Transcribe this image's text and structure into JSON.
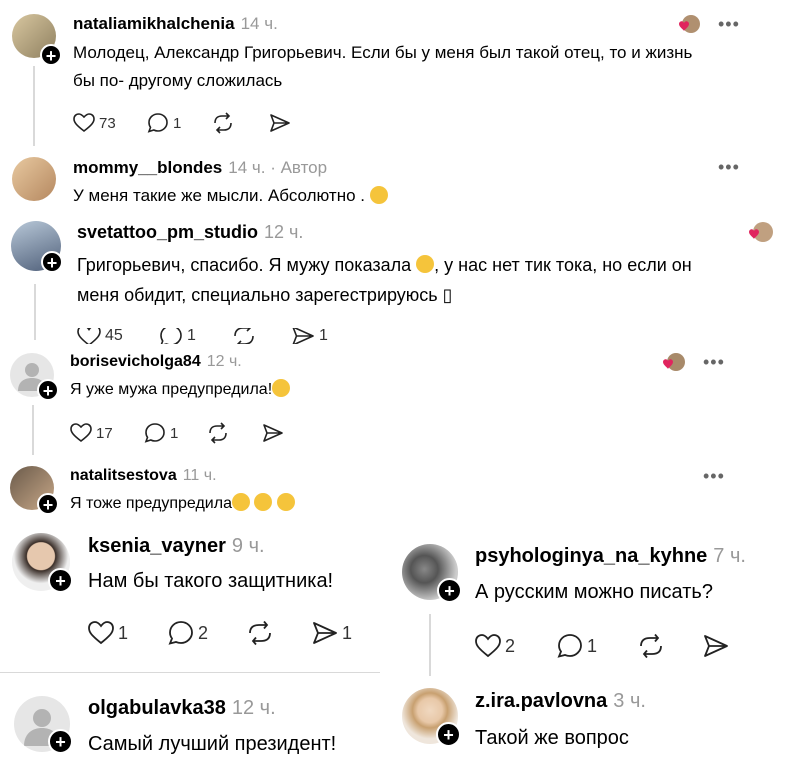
{
  "comments": [
    {
      "username": "nataliamikhalchenia",
      "time": "14 ч.",
      "text1": "Молодец, Александр Григорьевич. Если бы у меня был такой отец, то и жизнь",
      "text2": "бы по- другому сложилась",
      "likes": "73",
      "replies": "1"
    },
    {
      "username": "mommy__blondes",
      "time": "14 ч.",
      "author": " · Автор",
      "text": "У меня такие же мысли. Абсолютно ."
    },
    {
      "username": "svetattoo_pm_studio",
      "time": "12 ч.",
      "text1": "Григорьевич, спасибо. Я мужу показала",
      "text1b": ", у нас нет тик тока, но если он",
      "text2": "меня обидит, специально зарегестрируюсь ▯",
      "likes": "45",
      "replies": "1",
      "reposts": "",
      "shares": "1"
    },
    {
      "username": "borisevicholga84",
      "time": "12 ч.",
      "text": "Я уже мужа предупредила!",
      "likes": "17",
      "replies": "1"
    },
    {
      "username": "natalitsestova",
      "time": "11 ч.",
      "text": "Я тоже предупредила"
    },
    {
      "username": "ksenia_vayner",
      "time": "9 ч.",
      "text": "Нам бы такого защитника!",
      "likes": "1",
      "replies": "2",
      "shares": "1"
    },
    {
      "username": "psyhologinya_na_kyhne",
      "time": "7 ч.",
      "text": "А русским можно писать?",
      "likes": "2",
      "replies": "1"
    },
    {
      "username": "olgabulavka38",
      "time": "12 ч.",
      "text": "Самый лучший президент!"
    },
    {
      "username": "z.ira.pavlovna",
      "time": "3 ч.",
      "text": "Такой же вопрос"
    }
  ],
  "more_label": "•••",
  "plus": "+",
  "icons": {
    "like": "heart-icon",
    "reply": "comment-icon",
    "repost": "repost-icon",
    "share": "share-icon",
    "more": "more-icon"
  },
  "colors": {
    "heart": "#e0245e",
    "muted": "#999999",
    "divider": "#d9d9d9"
  }
}
